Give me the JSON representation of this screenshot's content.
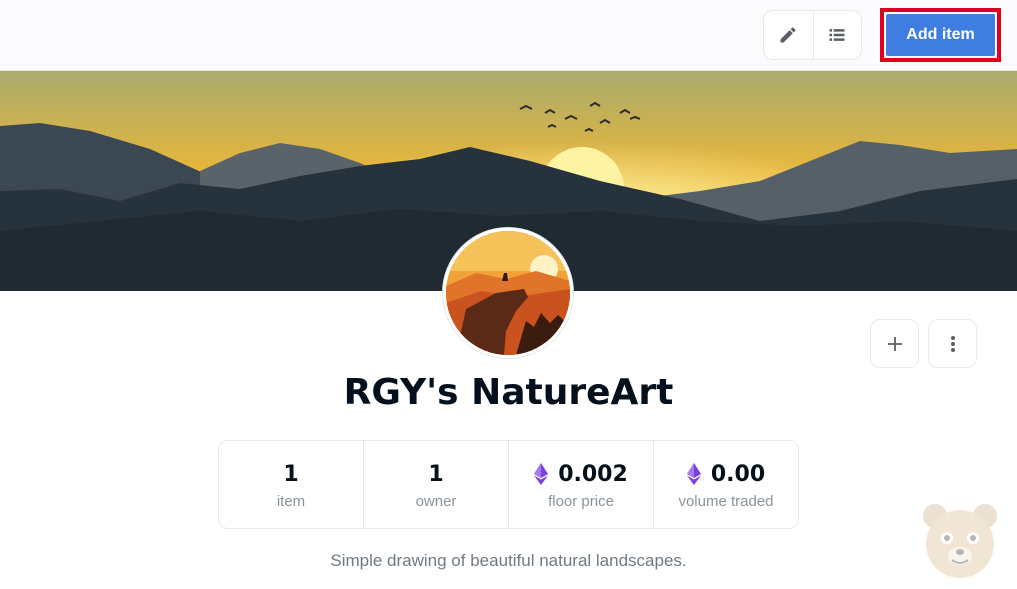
{
  "toolbar": {
    "edit_icon": "pencil-icon",
    "list_icon": "list-view-icon",
    "add_item_label": "Add item"
  },
  "collection": {
    "name": "RGY's NatureArt",
    "description": "Simple drawing of beautiful natural landscapes.",
    "stats": [
      {
        "value": "1",
        "label": "item",
        "icon": ""
      },
      {
        "value": "1",
        "label": "owner",
        "icon": ""
      },
      {
        "value": "0.002",
        "label": "floor price",
        "icon": "ethereum-icon"
      },
      {
        "value": "0.00",
        "label": "volume traded",
        "icon": "ethereum-icon"
      }
    ]
  },
  "actions": {
    "add_icon": "plus-icon",
    "more_icon": "more-vertical-icon"
  },
  "colors": {
    "accent": "#3f7ee0",
    "highlight_border": "#e0001b",
    "ethereum": "#7b3fe4"
  }
}
